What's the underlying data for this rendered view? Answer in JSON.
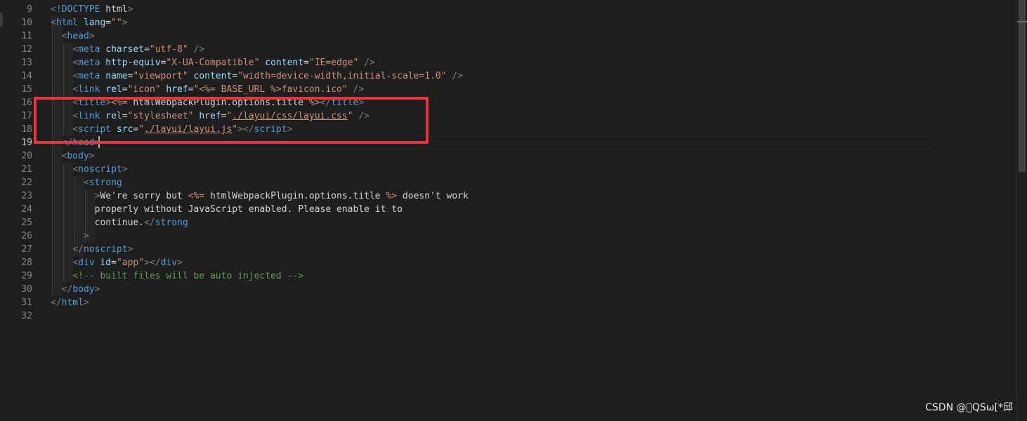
{
  "editor": {
    "line_numbers": [
      "9",
      "10",
      "11",
      "12",
      "13",
      "14",
      "15",
      "16",
      "17",
      "18",
      "19",
      "20",
      "21",
      "22",
      "23",
      "24",
      "25",
      "26",
      "27",
      "28",
      "29",
      "30",
      "31",
      "32"
    ],
    "active_line": "19",
    "lines": [
      [
        [
          "p",
          "<!"
        ],
        [
          "g",
          "DOCTYPE"
        ],
        [
          "t",
          " html"
        ],
        [
          "p",
          ">"
        ]
      ],
      [
        [
          "p",
          "<"
        ],
        [
          "g",
          "html"
        ],
        [
          "t",
          " "
        ],
        [
          "a",
          "lang"
        ],
        [
          "t",
          "="
        ],
        [
          "s",
          "\"\""
        ],
        [
          "p",
          ">"
        ]
      ],
      [
        [
          "t",
          "  "
        ],
        [
          "p",
          "<"
        ],
        [
          "g",
          "head"
        ],
        [
          "p",
          ">"
        ]
      ],
      [
        [
          "t",
          "    "
        ],
        [
          "p",
          "<"
        ],
        [
          "g",
          "meta"
        ],
        [
          "t",
          " "
        ],
        [
          "a",
          "charset"
        ],
        [
          "t",
          "="
        ],
        [
          "s",
          "\"utf-8\""
        ],
        [
          "t",
          " "
        ],
        [
          "p",
          "/>"
        ]
      ],
      [
        [
          "t",
          "    "
        ],
        [
          "p",
          "<"
        ],
        [
          "g",
          "meta"
        ],
        [
          "t",
          " "
        ],
        [
          "a",
          "http-equiv"
        ],
        [
          "t",
          "="
        ],
        [
          "s",
          "\"X-UA-Compatible\""
        ],
        [
          "t",
          " "
        ],
        [
          "a",
          "content"
        ],
        [
          "t",
          "="
        ],
        [
          "s",
          "\"IE=edge\""
        ],
        [
          "t",
          " "
        ],
        [
          "p",
          "/>"
        ]
      ],
      [
        [
          "t",
          "    "
        ],
        [
          "p",
          "<"
        ],
        [
          "g",
          "meta"
        ],
        [
          "t",
          " "
        ],
        [
          "a",
          "name"
        ],
        [
          "t",
          "="
        ],
        [
          "s",
          "\"viewport\""
        ],
        [
          "t",
          " "
        ],
        [
          "a",
          "content"
        ],
        [
          "t",
          "="
        ],
        [
          "s",
          "\"width=device-width,initial-scale=1.0\""
        ],
        [
          "t",
          " "
        ],
        [
          "p",
          "/>"
        ]
      ],
      [
        [
          "t",
          "    "
        ],
        [
          "p",
          "<"
        ],
        [
          "g",
          "link"
        ],
        [
          "t",
          " "
        ],
        [
          "a",
          "rel"
        ],
        [
          "t",
          "="
        ],
        [
          "s",
          "\"icon\""
        ],
        [
          "t",
          " "
        ],
        [
          "a",
          "href"
        ],
        [
          "t",
          "="
        ],
        [
          "s",
          "\"<%= BASE_URL %>favicon.ico\""
        ],
        [
          "t",
          " "
        ],
        [
          "p",
          "/>"
        ]
      ],
      [
        [
          "t",
          "    "
        ],
        [
          "p",
          "<"
        ],
        [
          "g",
          "title"
        ],
        [
          "p",
          ">"
        ],
        [
          "s",
          "<%="
        ],
        [
          "t",
          " htmlWebpackPlugin.options.title "
        ],
        [
          "s",
          "%>"
        ],
        [
          "p",
          "</"
        ],
        [
          "g",
          "title"
        ],
        [
          "p",
          ">"
        ]
      ],
      [
        [
          "t",
          "    "
        ],
        [
          "p",
          "<"
        ],
        [
          "g",
          "link"
        ],
        [
          "t",
          " "
        ],
        [
          "a",
          "rel"
        ],
        [
          "t",
          "="
        ],
        [
          "s",
          "\"stylesheet\""
        ],
        [
          "t",
          " "
        ],
        [
          "a",
          "href"
        ],
        [
          "t",
          "="
        ],
        [
          "s",
          "\""
        ],
        [
          "su",
          "./layui/css/layui.css"
        ],
        [
          "s",
          "\""
        ],
        [
          "t",
          " "
        ],
        [
          "p",
          "/>"
        ]
      ],
      [
        [
          "t",
          "    "
        ],
        [
          "p",
          "<"
        ],
        [
          "g",
          "script"
        ],
        [
          "t",
          " "
        ],
        [
          "a",
          "src"
        ],
        [
          "t",
          "="
        ],
        [
          "s",
          "\""
        ],
        [
          "su",
          "./layui/layui.js"
        ],
        [
          "s",
          "\""
        ],
        [
          "p",
          "></"
        ],
        [
          "g",
          "script"
        ],
        [
          "p",
          ">"
        ]
      ],
      [
        [
          "t",
          "  "
        ],
        [
          "p",
          "</"
        ],
        [
          "g",
          "head"
        ],
        [
          "p",
          ">"
        ]
      ],
      [
        [
          "t",
          "  "
        ],
        [
          "p",
          "<"
        ],
        [
          "g",
          "body"
        ],
        [
          "p",
          ">"
        ]
      ],
      [
        [
          "t",
          "    "
        ],
        [
          "p",
          "<"
        ],
        [
          "g",
          "noscript"
        ],
        [
          "p",
          ">"
        ]
      ],
      [
        [
          "t",
          "      "
        ],
        [
          "p",
          "<"
        ],
        [
          "g",
          "strong"
        ]
      ],
      [
        [
          "t",
          "        "
        ],
        [
          "p",
          ">"
        ],
        [
          "t",
          "We're sorry but "
        ],
        [
          "s",
          "<%="
        ],
        [
          "t",
          " htmlWebpackPlugin.options.title "
        ],
        [
          "s",
          "%>"
        ],
        [
          "t",
          " doesn't work"
        ]
      ],
      [
        [
          "t",
          "        properly without JavaScript enabled. Please enable it to"
        ]
      ],
      [
        [
          "t",
          "        continue."
        ],
        [
          "p",
          "</"
        ],
        [
          "g",
          "strong"
        ]
      ],
      [
        [
          "t",
          "      "
        ],
        [
          "p",
          ">"
        ]
      ],
      [
        [
          "t",
          "    "
        ],
        [
          "p",
          "</"
        ],
        [
          "g",
          "noscript"
        ],
        [
          "p",
          ">"
        ]
      ],
      [
        [
          "t",
          "    "
        ],
        [
          "p",
          "<"
        ],
        [
          "g",
          "div"
        ],
        [
          "t",
          " "
        ],
        [
          "a",
          "id"
        ],
        [
          "t",
          "="
        ],
        [
          "s",
          "\"app\""
        ],
        [
          "p",
          "></"
        ],
        [
          "g",
          "div"
        ],
        [
          "p",
          ">"
        ]
      ],
      [
        [
          "t",
          "    "
        ],
        [
          "c",
          "<!-- built files will be auto injected -->"
        ]
      ],
      [
        [
          "t",
          "  "
        ],
        [
          "p",
          "</"
        ],
        [
          "g",
          "body"
        ],
        [
          "p",
          ">"
        ]
      ],
      [
        [
          "p",
          "</"
        ],
        [
          "g",
          "html"
        ],
        [
          "p",
          ">"
        ]
      ],
      [
        [
          "t",
          ""
        ]
      ]
    ]
  },
  "colors": {
    "background": "#1e1e1e",
    "annotation": "#e8353a",
    "tag": "#569cd6",
    "attribute": "#9cdcfe",
    "string": "#ce9178",
    "comment": "#6a9955"
  },
  "watermark": "CSDN @\u0000QSω[*邱"
}
